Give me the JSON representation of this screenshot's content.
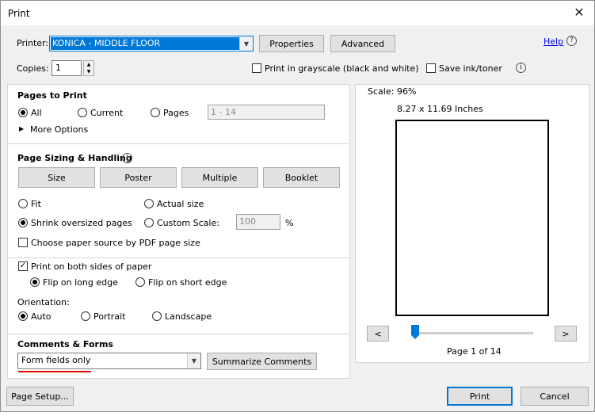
{
  "window": {
    "title": "Print",
    "close_glyph": "✕"
  },
  "printer": {
    "label": "Printer:",
    "selected": "KONICA - MIDDLE FLOOR",
    "properties_label": "Properties",
    "advanced_label": "Advanced",
    "help_label": "Help"
  },
  "copies": {
    "label": "Copies:",
    "value": "1"
  },
  "options": {
    "grayscale_label": "Print in grayscale (black and white)",
    "save_ink_label": "Save ink/toner"
  },
  "pages_to_print": {
    "heading": "Pages to Print",
    "all_label": "All",
    "current_label": "Current",
    "pages_label": "Pages",
    "pages_placeholder": "1 - 14",
    "more_options_label": "More Options"
  },
  "sizing": {
    "heading": "Page Sizing & Handling",
    "size_label": "Size",
    "poster_label": "Poster",
    "multiple_label": "Multiple",
    "booklet_label": "Booklet",
    "fit_label": "Fit",
    "actual_size_label": "Actual size",
    "shrink_label": "Shrink oversized pages",
    "custom_scale_label": "Custom Scale:",
    "custom_scale_value": "100",
    "percent": "%",
    "paper_source_label": "Choose paper source by PDF page size"
  },
  "duplex": {
    "both_sides_label": "Print on both sides of paper",
    "long_edge_label": "Flip on long edge",
    "short_edge_label": "Flip on short edge"
  },
  "orientation": {
    "label": "Orientation:",
    "auto_label": "Auto",
    "portrait_label": "Portrait",
    "landscape_label": "Landscape"
  },
  "comments": {
    "heading": "Comments & Forms",
    "selected": "Form fields only",
    "summarize_label": "Summarize Comments"
  },
  "preview": {
    "scale_label": "Scale:",
    "scale_value": "96%",
    "page_size": "8.27 x 11.69 Inches",
    "prev_glyph": "<",
    "next_glyph": ">",
    "page_indicator": "Page 1 of 14",
    "current_page": 1,
    "total_pages": 14
  },
  "footer": {
    "page_setup_label": "Page Setup...",
    "print_label": "Print",
    "cancel_label": "Cancel"
  },
  "colors": {
    "selection_blue": "#0078d7",
    "annotation_red": "#e00000",
    "link_blue": "#0000ee"
  }
}
